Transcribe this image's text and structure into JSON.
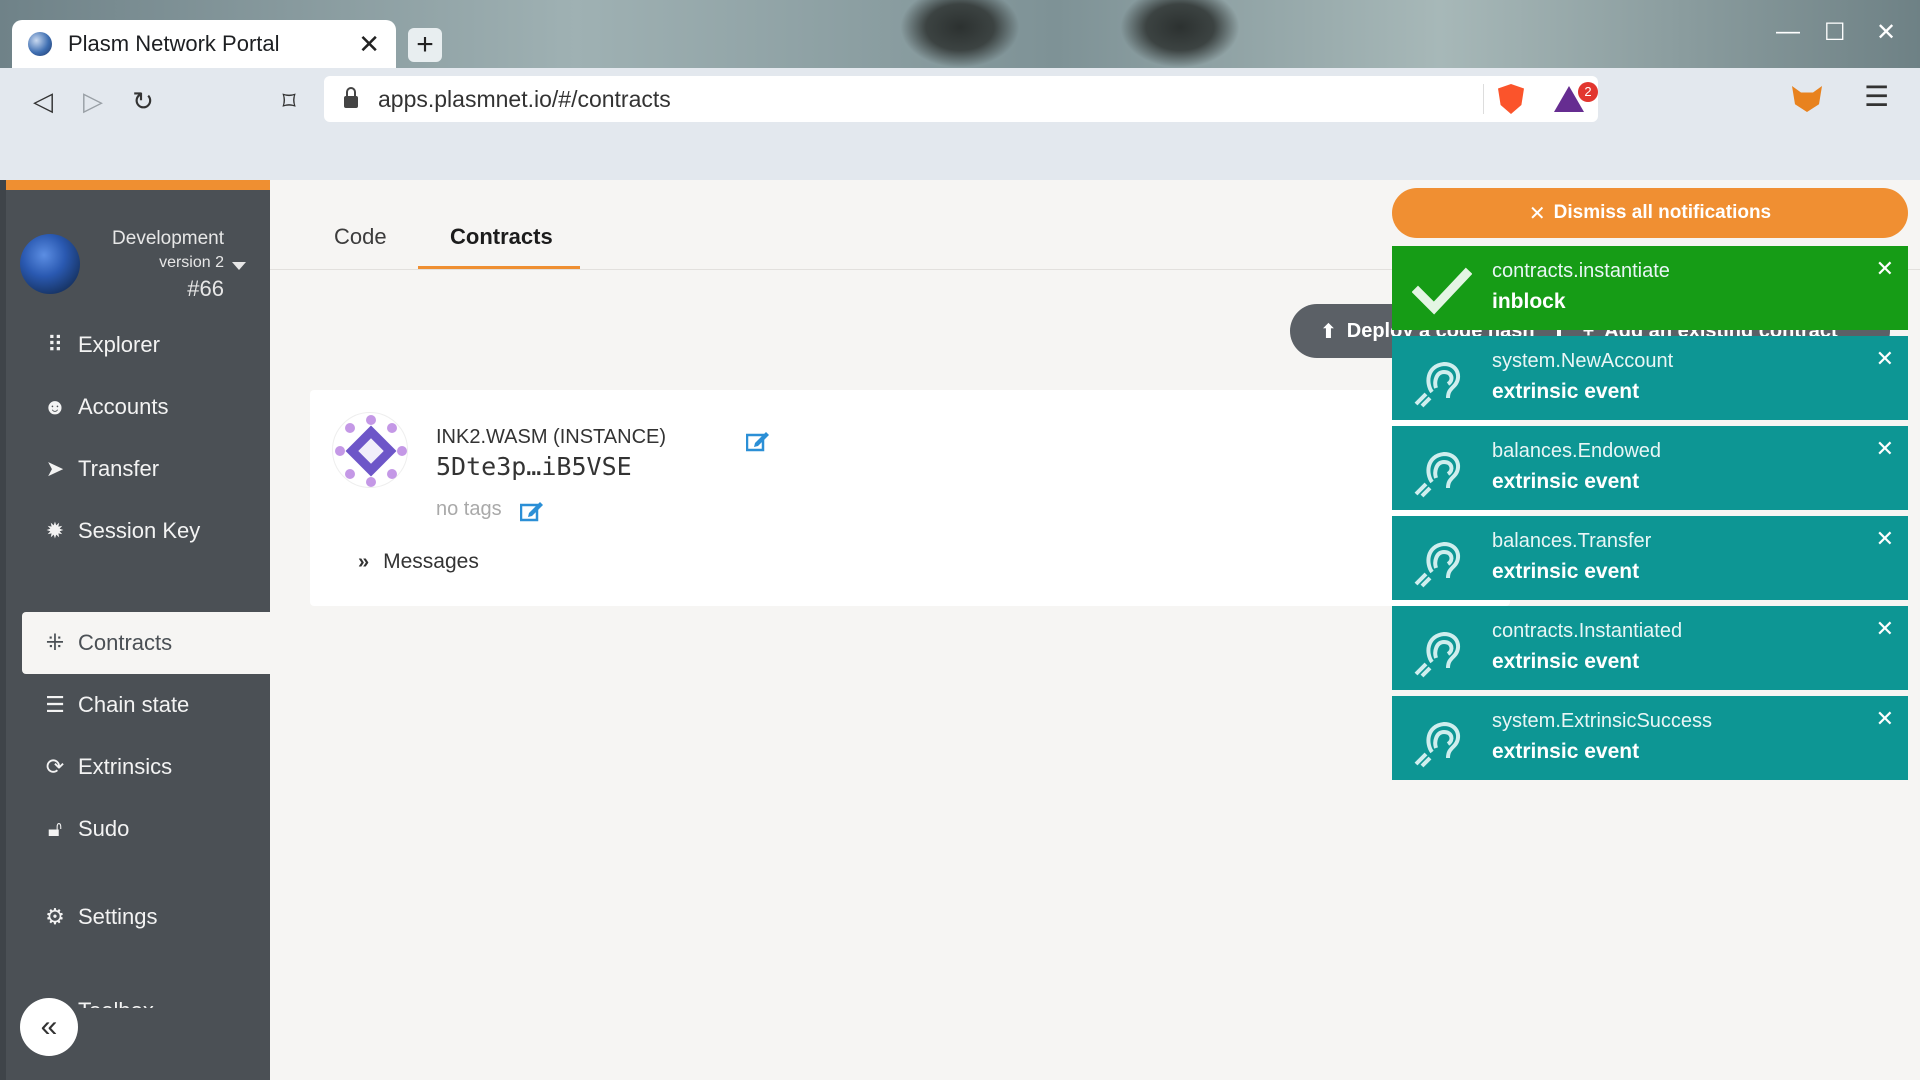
{
  "browser": {
    "tab_title": "Plasm Network Portal",
    "url": "apps.plasmnet.io/#/contracts",
    "rewards_badge": "2"
  },
  "node": {
    "chain": "Development",
    "version": "version 2",
    "block": "#66"
  },
  "sidebar": {
    "items": [
      {
        "label": "Explorer",
        "icon": "explorer-icon"
      },
      {
        "label": "Accounts",
        "icon": "users-icon"
      },
      {
        "label": "Transfer",
        "icon": "paper-plane-icon"
      },
      {
        "label": "Session Key",
        "icon": "gear-icon"
      },
      {
        "label": "Contracts",
        "icon": "compress-icon"
      },
      {
        "label": "Chain state",
        "icon": "database-icon"
      },
      {
        "label": "Extrinsics",
        "icon": "sync-icon"
      },
      {
        "label": "Sudo",
        "icon": "unlock-icon"
      },
      {
        "label": "Settings",
        "icon": "cogs-icon"
      },
      {
        "label": "Toolbox",
        "icon": "tools-icon"
      }
    ]
  },
  "main": {
    "tabs": [
      {
        "label": "Code"
      },
      {
        "label": "Contracts"
      }
    ],
    "deploy_label": "Deploy a code hash",
    "add_label": "Add an existing contract"
  },
  "contract": {
    "name": "INK2.WASM (INSTANCE)",
    "address": "5Dte3p…iB5VSE",
    "tags": "no tags",
    "messages_label": "Messages"
  },
  "notifications": {
    "dismiss_label": "Dismiss all notifications",
    "items": [
      {
        "title": "contracts.instantiate",
        "status": "inblock",
        "kind": "success"
      },
      {
        "title": "system.NewAccount",
        "status": "extrinsic event",
        "kind": "event"
      },
      {
        "title": "balances.Endowed",
        "status": "extrinsic event",
        "kind": "event"
      },
      {
        "title": "balances.Transfer",
        "status": "extrinsic event",
        "kind": "event"
      },
      {
        "title": "contracts.Instantiated",
        "status": "extrinsic event",
        "kind": "event"
      },
      {
        "title": "system.ExtrinsicSuccess",
        "status": "extrinsic event",
        "kind": "event"
      }
    ]
  },
  "colors": {
    "accent": "#ef8f31",
    "sidebar": "#4b5055",
    "notification_event": "#0d9694",
    "notification_success": "#169c16"
  }
}
